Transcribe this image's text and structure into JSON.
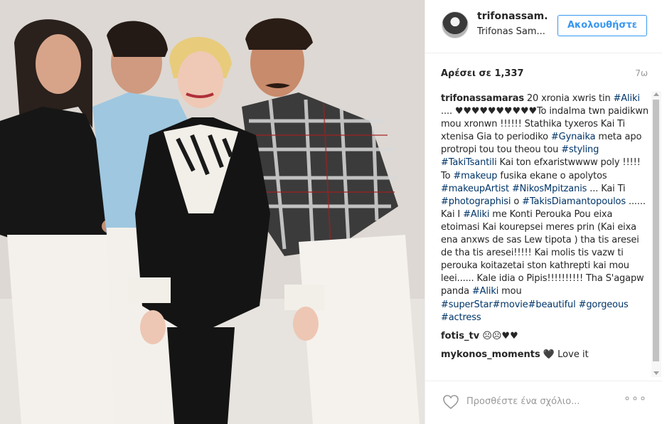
{
  "post": {
    "photo_alt": "",
    "header": {
      "username": "trifonassam...",
      "full_name": "Trifonas Sam...",
      "follow_label": "Ακολουθήστε"
    },
    "likes_label": "Αρέσει σε 1,337",
    "time_label": "7ω",
    "caption": {
      "username": "trifonassamaras",
      "parts": [
        {
          "t": "text",
          "v": " 20 xronia xwris tin "
        },
        {
          "t": "tag",
          "v": "#Aliki"
        },
        {
          "t": "text",
          "v": " .... ♥♥♥♥♥♥♥♥♥♥To indalma twn paidikwn mou xronwn !!!!!! Stathika tyxeros Kai Ti xtenisa Gia to periodiko "
        },
        {
          "t": "tag",
          "v": "#Gynaika"
        },
        {
          "t": "text",
          "v": " meta apo protropi tou tou theou tou "
        },
        {
          "t": "tag",
          "v": "#styling"
        },
        {
          "t": "text",
          "v": " "
        },
        {
          "t": "tag",
          "v": "#TakiTsantili"
        },
        {
          "t": "text",
          "v": " Kai ton efxaristwwww poly !!!!! To "
        },
        {
          "t": "tag",
          "v": "#makeup"
        },
        {
          "t": "text",
          "v": " fusika ekane o apolytos "
        },
        {
          "t": "tag",
          "v": "#makeupArtist"
        },
        {
          "t": "text",
          "v": " "
        },
        {
          "t": "tag",
          "v": "#NikosMpitzanis"
        },
        {
          "t": "text",
          "v": " ... Kai Ti "
        },
        {
          "t": "tag",
          "v": "#photographisi"
        },
        {
          "t": "text",
          "v": " o "
        },
        {
          "t": "tag",
          "v": "#TakisDiamantopoulos"
        },
        {
          "t": "text",
          "v": " ...... Kai I "
        },
        {
          "t": "tag",
          "v": "#Aliki"
        },
        {
          "t": "text",
          "v": " me Konti Perouka Pou eixa etoimasi Kai kourepsei meres prin (Kai eixa ena anxws de sas Lew tipota ) tha tis aresei de tha tis aresei!!!!! Kai molis tis vazw ti perouka koitazetai ston kathrepti kai mou leei...... Kale idia o Pipis!!!!!!!!!! Tha S'agapw panda "
        },
        {
          "t": "tag",
          "v": "#Aliki"
        },
        {
          "t": "text",
          "v": " mou "
        },
        {
          "t": "tag",
          "v": "#superStar"
        },
        {
          "t": "tag",
          "v": "#movie"
        },
        {
          "t": "tag",
          "v": "#beautiful"
        },
        {
          "t": "text",
          "v": " "
        },
        {
          "t": "tag",
          "v": "#gorgeous"
        },
        {
          "t": "text",
          "v": " "
        },
        {
          "t": "tag",
          "v": "#actress"
        }
      ]
    },
    "comments": [
      {
        "username": "fotis_tv",
        "text": " ☹☹♥♥"
      },
      {
        "username": "mykonos_moments",
        "text": " 🖤 Love it"
      }
    ],
    "footer": {
      "comment_placeholder": "Προσθέστε ένα σχόλιο...",
      "more_label": "∘∘∘"
    }
  },
  "colors": {
    "follow_blue": "#3897f0",
    "hashtag_blue": "#003569",
    "muted_gray": "#999999",
    "text": "#262626"
  },
  "icons": {
    "like": "heart-outline-icon",
    "more": "ellipsis-icon"
  }
}
